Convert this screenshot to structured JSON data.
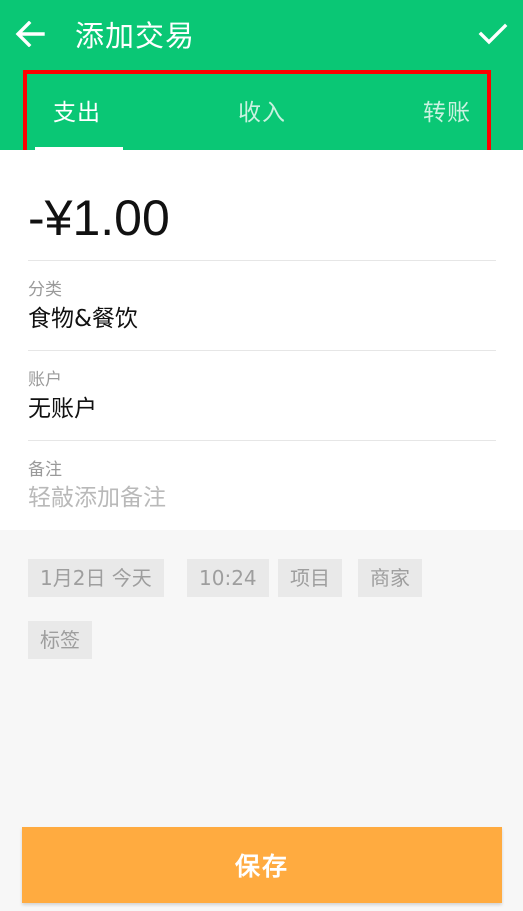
{
  "header": {
    "title": "添加交易",
    "back_icon": "arrow-left-icon",
    "confirm_icon": "check-icon",
    "background_color": "#0ac775"
  },
  "tabs": [
    {
      "label": "支出",
      "selected": true
    },
    {
      "label": "收入",
      "selected": false
    },
    {
      "label": "转账",
      "selected": false
    }
  ],
  "form": {
    "amount": "-¥1.00",
    "category": {
      "label": "分类",
      "value": "食物&餐饮"
    },
    "account": {
      "label": "账户",
      "value": "无账户"
    },
    "note": {
      "label": "备注",
      "placeholder": "轻敲添加备注"
    }
  },
  "chips": {
    "date": "1月2日  今天",
    "time": "10:24",
    "project": "项目",
    "merchant": "商家",
    "tag": "标签"
  },
  "save_button": {
    "label": "保存",
    "color": "#ffab40"
  }
}
